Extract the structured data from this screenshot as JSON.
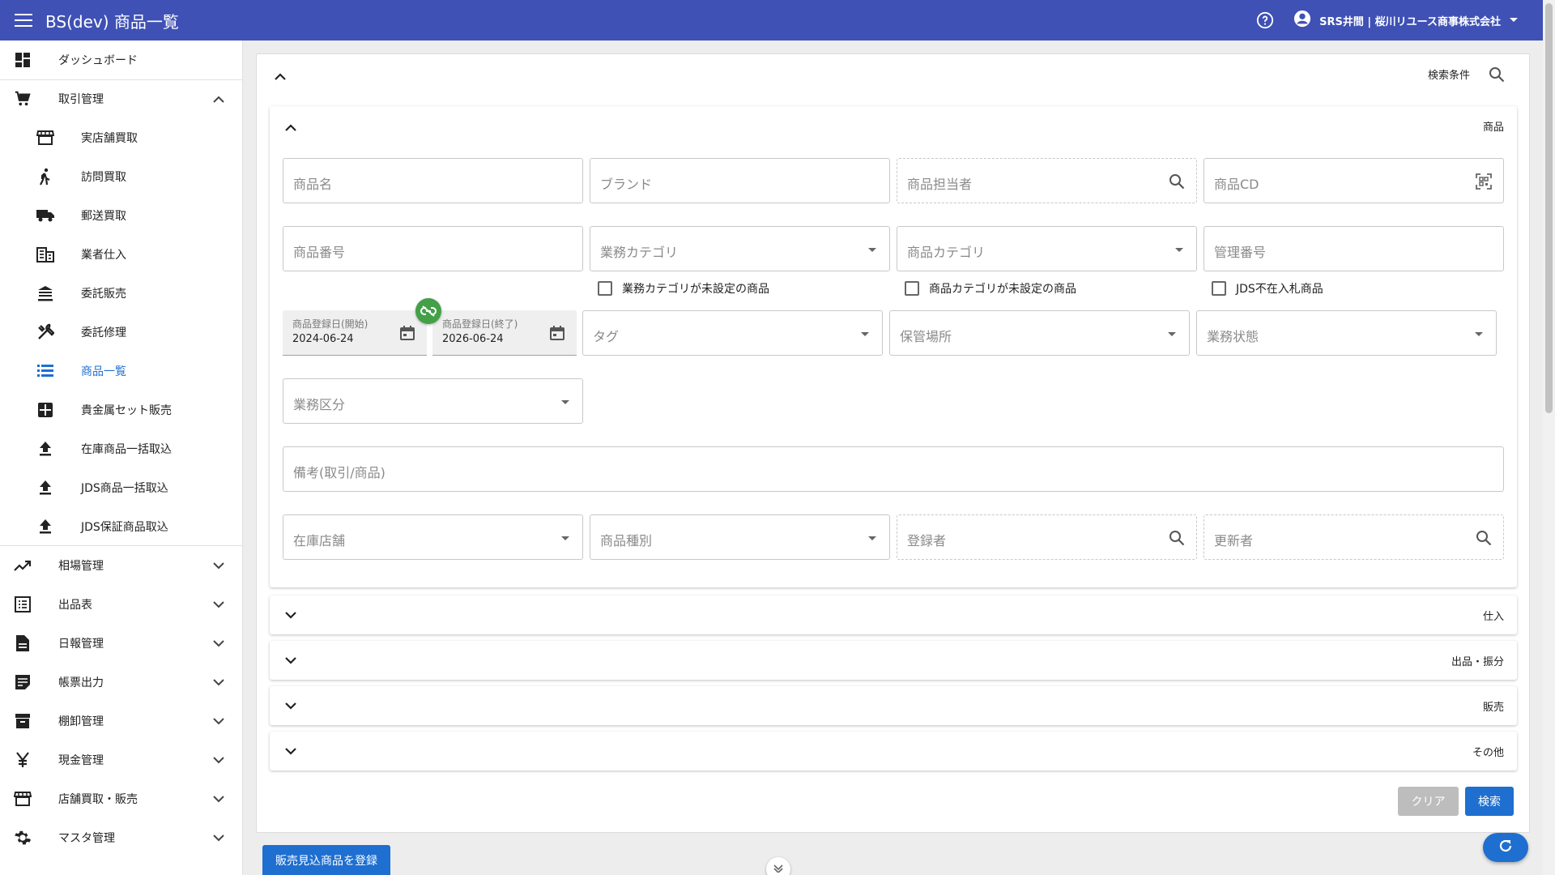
{
  "appbar": {
    "title": "BS(dev) 商品一覧",
    "user": "SRS井間 | 桜川リユース商事株式会社",
    "bg_color": "#3f51b5"
  },
  "sidebar": {
    "items": [
      {
        "label": "ダッシュボード",
        "icon": "dashboard-icon"
      },
      {
        "label": "取引管理",
        "icon": "cart-icon",
        "expanded": true
      },
      {
        "label": "実店舗買取",
        "icon": "store-icon"
      },
      {
        "label": "訪問買取",
        "icon": "walk-icon"
      },
      {
        "label": "郵送買取",
        "icon": "truck-icon"
      },
      {
        "label": "業者仕入",
        "icon": "building-icon"
      },
      {
        "label": "委託販売",
        "icon": "bank-icon"
      },
      {
        "label": "委託修理",
        "icon": "tools-icon"
      },
      {
        "label": "商品一覧",
        "icon": "list-icon",
        "active": true
      },
      {
        "label": "貴金属セット販売",
        "icon": "grid-icon"
      },
      {
        "label": "在庫商品一括取込",
        "icon": "upload-icon"
      },
      {
        "label": "JDS商品一括取込",
        "icon": "upload-icon"
      },
      {
        "label": "JDS保証商品取込",
        "icon": "upload-icon"
      },
      {
        "label": "相場管理",
        "icon": "trending-icon"
      },
      {
        "label": "出品表",
        "icon": "list-alt-icon"
      },
      {
        "label": "日報管理",
        "icon": "document-icon"
      },
      {
        "label": "帳票出力",
        "icon": "note-icon"
      },
      {
        "label": "棚卸管理",
        "icon": "archive-icon"
      },
      {
        "label": "現金管理",
        "icon": "yen-icon"
      },
      {
        "label": "店舗買取・販売",
        "icon": "store-icon"
      },
      {
        "label": "マスタ管理",
        "icon": "gear-icon"
      }
    ]
  },
  "search": {
    "title": "検索条件",
    "product_section": "商品",
    "fields": {
      "product_name": "商品名",
      "brand": "ブランド",
      "product_staff": "商品担当者",
      "product_cd": "商品CD",
      "product_number": "商品番号",
      "business_category": "業務カテゴリ",
      "product_category": "商品カテゴリ",
      "management_number": "管理番号",
      "tag": "タグ",
      "storage": "保管場所",
      "business_status": "業務状態",
      "business_division": "業務区分",
      "remarks": "備考(取引/商品)",
      "stock_store": "在庫店舗",
      "product_type": "商品種別",
      "registrant": "登録者",
      "updater": "更新者"
    },
    "checkboxes": {
      "no_business_category": "業務カテゴリが未設定の商品",
      "no_product_category": "商品カテゴリが未設定の商品",
      "jds_absent": "JDS不在入札商品"
    },
    "dates": {
      "start_label": "商品登録日(開始)",
      "start_value": "2024-06-24",
      "end_label": "商品登録日(終了)",
      "end_value": "2026-06-24"
    },
    "collapsed_sections": [
      "仕入",
      "出品・振分",
      "販売",
      "その他"
    ],
    "clear_label": "クリア",
    "search_label": "検索"
  },
  "footer": {
    "register_label": "販売見込商品を登録"
  }
}
